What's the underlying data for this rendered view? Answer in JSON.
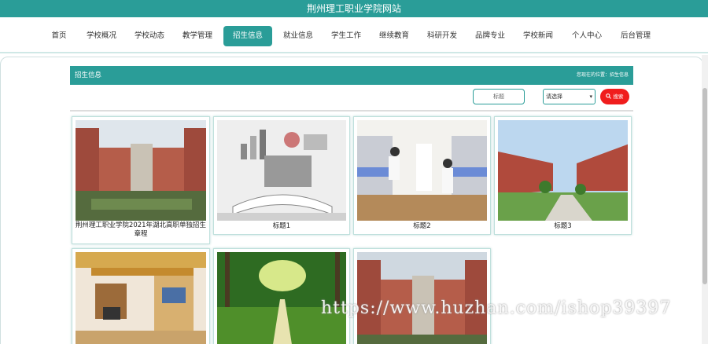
{
  "header": {
    "title": "荆州理工职业学院网站"
  },
  "nav": {
    "items": [
      {
        "label": "首页"
      },
      {
        "label": "学校概况"
      },
      {
        "label": "学校动态"
      },
      {
        "label": "教学管理"
      },
      {
        "label": "招生信息",
        "active": true
      },
      {
        "label": "就业信息"
      },
      {
        "label": "学生工作"
      },
      {
        "label": "继续教育"
      },
      {
        "label": "科研开发"
      },
      {
        "label": "品牌专业"
      },
      {
        "label": "学校新闻"
      },
      {
        "label": "个人中心"
      },
      {
        "label": "后台管理"
      }
    ]
  },
  "section": {
    "title": "招生信息",
    "breadcrumb": "您现在的位置：招生信息"
  },
  "search": {
    "placeholder": "标题",
    "select_value": "请选择",
    "button_label": "搜索"
  },
  "cards": [
    {
      "caption": "荆州理工职业学院2021年湖北高职单独招生章程",
      "image": "campus-building"
    },
    {
      "caption": "标题1",
      "image": "open-book-infographic"
    },
    {
      "caption": "标题2",
      "image": "dormitory-room"
    },
    {
      "caption": "标题3",
      "image": "campus-buildings-lawn"
    },
    {
      "caption": "",
      "image": "dorm-desk-bed"
    },
    {
      "caption": "",
      "image": "tree-lined-path"
    },
    {
      "caption": "",
      "image": "campus-building"
    }
  ],
  "watermark": "https://www.huzhan.com/ishop39397",
  "colors": {
    "accent": "#2a9d98",
    "search_button": "#f01d1d"
  }
}
